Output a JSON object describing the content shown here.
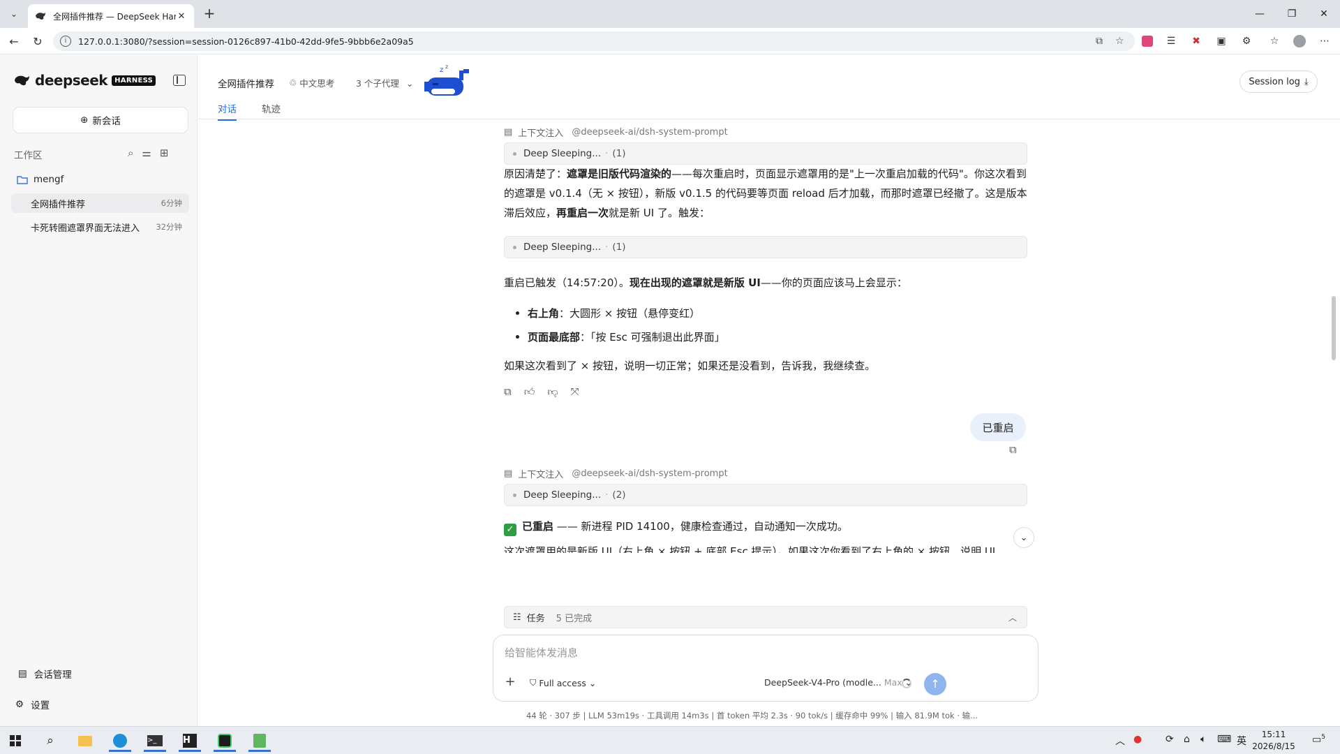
{
  "browser": {
    "tab_title": "全网插件推荐 — DeepSeek Harne:",
    "url": "127.0.0.1:3080/?session=session-0126c897-41b0-42dd-9fe5-9bbb6e2a09a5"
  },
  "sidebar": {
    "logo_text": "deepseek",
    "logo_badge": "HARNESS",
    "new_chat": "新会话",
    "workspace_label": "工作区",
    "folder": "mengf",
    "sessions": [
      {
        "name": "全网插件推荐",
        "time": "6分钟"
      },
      {
        "name": "卡死转圈遮罩界面无法进入",
        "time": "32分钟"
      }
    ],
    "manage": "会话管理",
    "settings": "设置"
  },
  "header": {
    "title": "全网插件推荐",
    "thinking": "中文思考",
    "agents": "3 个子代理",
    "session_log": "Session log",
    "tabs": [
      "对话",
      "轨迹"
    ]
  },
  "chat": {
    "ctx_label": "上下文注入",
    "ctx_source": "@deepseek-ai/dsh-system-prompt",
    "sleep_label": "Deep Sleeping...",
    "sleep_count_1": "(1)",
    "sleep_count_2": "(1)",
    "sleep_count_3": "(2)",
    "p1_a": "原因清楚了：",
    "p1_b": "遮罩是旧版代码渲染的",
    "p1_c": "——每次重启时，页面显示遮罩用的是\"上一次重启加载的代码\"。你这次看到的遮罩是 v0.1.4（无 × 按钮），新版 v0.1.5 的代码要等页面 reload 后才加载，而那时遮罩已经撤了。这是版本滞后效应，",
    "p1_d": "再重启一次",
    "p1_e": "就是新 UI 了。触发：",
    "p2_a": "重启已触发（14:57:20）。",
    "p2_b": "现在出现的遮罩就是新版 UI",
    "p2_c": "——你的页面应该马上会显示：",
    "b1_k": "右上角",
    "b1_v": "：大圆形 × 按钮（悬停变红）",
    "b2_k": "页面最底部",
    "b2_v": "：「按 Esc 可强制退出此界面」",
    "p3": "如果这次看到了 × 按钮，说明一切正常；如果还是没看到，告诉我，我继续查。",
    "user_msg": "已重启",
    "p4_a": "已重启",
    "p4_b": " —— 新进程 PID 14100，健康检查通过，自动通知一次成功。",
    "p5": "这次遮罩用的是新版 UI（右上角 × 按钮 + 底部 Esc 提示）。如果这次你看到了右上角的 × 按钮，说明 UI"
  },
  "tasks": {
    "label": "任务",
    "done": "5 已完成"
  },
  "composer": {
    "placeholder": "给智能体发消息",
    "access": "Full access",
    "model": "DeepSeek-V4-Pro (modle...",
    "max": "Max"
  },
  "stats": "44 轮 · 307 步  |  LLM 53m19s · 工具调用 14m3s  |  首 token 平均 2.3s · 90 tok/s  |  缓存命中 99%  |  输入 81.9M tok · 输...",
  "clock": {
    "time": "15:11",
    "date": "2026/8/15"
  },
  "tray": {
    "ime": "英",
    "notif": "5"
  }
}
